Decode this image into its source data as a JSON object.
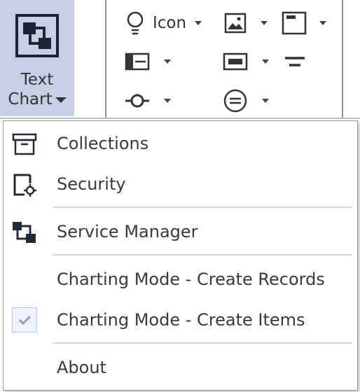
{
  "ribbon": {
    "text_chart": {
      "line1": "Text",
      "line2": "Chart"
    },
    "icon_label": "Icon"
  },
  "menu": {
    "collections": "Collections",
    "security": "Security",
    "service_manager": "Service Manager",
    "create_records": "Charting Mode - Create Records",
    "create_items": "Charting Mode - Create Items",
    "about": "About"
  }
}
